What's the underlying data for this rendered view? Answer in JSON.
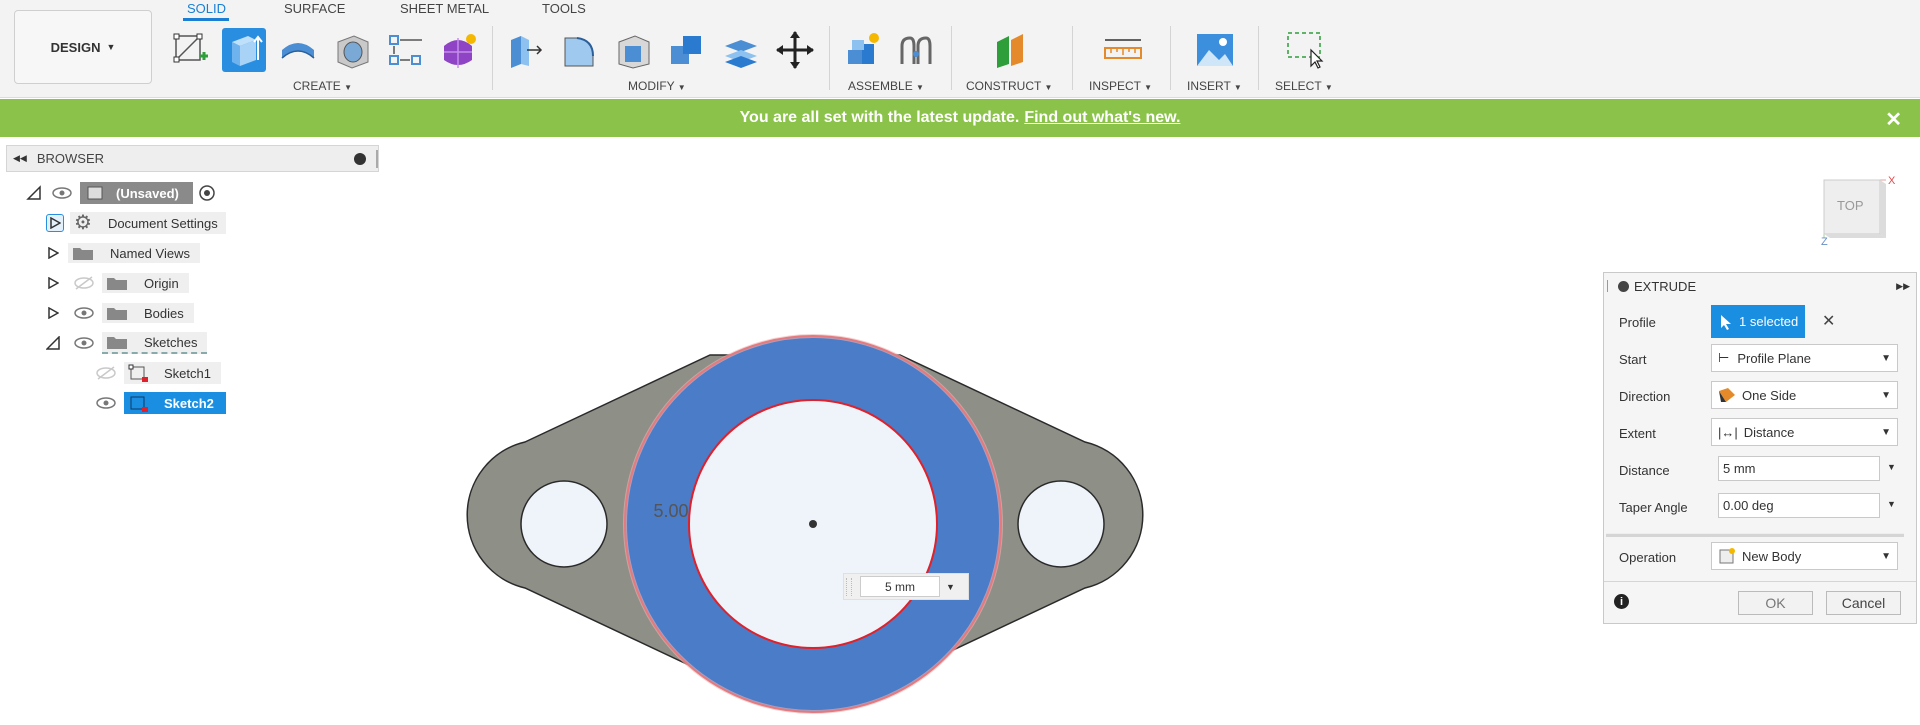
{
  "workspace": {
    "label": "DESIGN"
  },
  "tabs": [
    {
      "label": "SOLID",
      "active": true
    },
    {
      "label": "SURFACE"
    },
    {
      "label": "SHEET METAL"
    },
    {
      "label": "TOOLS"
    }
  ],
  "groups": {
    "create": "CREATE",
    "modify": "MODIFY",
    "assemble": "ASSEMBLE",
    "construct": "CONSTRUCT",
    "inspect": "INSPECT",
    "insert": "INSERT",
    "select": "SELECT"
  },
  "banner": {
    "text": "You are all set with the latest update.",
    "link": "Find out what's new."
  },
  "browser": {
    "title": "BROWSER",
    "root": "(Unsaved)",
    "items": [
      {
        "label": "Document Settings"
      },
      {
        "label": "Named Views"
      },
      {
        "label": "Origin"
      },
      {
        "label": "Bodies"
      },
      {
        "label": "Sketches"
      }
    ],
    "sketches": [
      {
        "label": "Sketch1"
      },
      {
        "label": "Sketch2",
        "selected": true
      }
    ]
  },
  "viewcube": {
    "face": "TOP",
    "axis_x": "X",
    "axis_z": "Z"
  },
  "canvas": {
    "dimension_text": "5.00",
    "distance_value": "5 mm"
  },
  "extrude": {
    "title": "EXTRUDE",
    "profile": {
      "label": "Profile",
      "value": "1 selected"
    },
    "start": {
      "label": "Start",
      "value": "Profile Plane"
    },
    "direction": {
      "label": "Direction",
      "value": "One Side"
    },
    "extent": {
      "label": "Extent",
      "value": "Distance"
    },
    "distance": {
      "label": "Distance",
      "value": "5 mm"
    },
    "taper": {
      "label": "Taper Angle",
      "value": "0.00 deg"
    },
    "operation": {
      "label": "Operation",
      "value": "New Body"
    },
    "ok": "OK",
    "cancel": "Cancel"
  },
  "colors": {
    "accent": "#2a8ee0",
    "banner": "#8bc34a",
    "profile_fill": "#4a7cc7",
    "body_gray": "#8e8f87",
    "hole_fill": "#eef4fa",
    "sketch_red": "#e0202a"
  }
}
